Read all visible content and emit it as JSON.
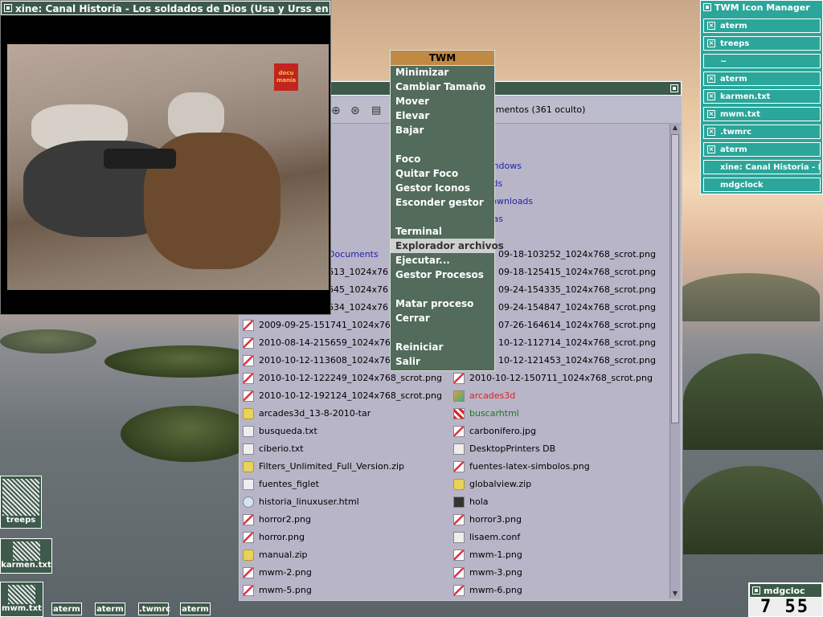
{
  "xine": {
    "title": "xine: Canal Historia - Los soldados de Dios (Usa y Urss en Afg",
    "logo": "docu mania"
  },
  "menu": {
    "title": "TWM",
    "items": [
      "Minimizar",
      "Cambiar Tamaño",
      "Mover",
      "Elevar",
      "Bajar",
      "Foco",
      "Quitar Foco",
      "Gestor Iconos",
      "Esconder gestor",
      "Terminal",
      "Explorador archivos",
      "Ejecutar...",
      "Gestor Procesos",
      "Matar proceso",
      "Cerrar",
      "Reiniciar",
      "Salir"
    ],
    "selected": "Explorador archivos"
  },
  "iconmgr": {
    "title": "TWM Icon Manager",
    "items": [
      "aterm",
      "treeps",
      "~",
      "aterm",
      "karmen.txt",
      "mwm.txt",
      ".twmrc",
      "aterm",
      "xine: Canal Historia - Los",
      "mdgclock"
    ]
  },
  "fm": {
    "status": "ementos (361 oculto)",
    "col_top": [
      "_windows",
      "loads",
      "aDownloads",
      "amas"
    ],
    "left": [
      "Documents",
      "613_1024x76",
      "645_1024x76",
      "634_1024x76",
      "2009-09-25-151741_1024x76",
      "2010-08-14-215659_1024x76",
      "2010-10-12-113608_1024x76",
      "2010-10-12-122249_1024x768_scrot.png",
      "2010-10-12-192124_1024x768_scrot.png",
      "arcades3d_13-8-2010-tar",
      "busqueda.txt",
      "ciberio.txt",
      "Filters_Unlimited_Full_Version.zip",
      "fuentes_figlet",
      "historia_linuxuser.html",
      "horror2.png",
      "horror.png",
      "manual.zip",
      "mwm-2.png",
      "mwm-5.png"
    ],
    "right": [
      "09-18-103252_1024x768_scrot.png",
      "09-18-125415_1024x768_scrot.png",
      "09-24-154335_1024x768_scrot.png",
      "09-24-154847_1024x768_scrot.png",
      "07-26-164614_1024x768_scrot.png",
      "10-12-112714_1024x768_scrot.png",
      "10-12-121453_1024x768_scrot.png",
      "2010-10-12-150711_1024x768_scrot.png",
      "arcades3d",
      "buscarhtml",
      "carbonifero.jpg",
      "DesktopPrinters DB",
      "fuentes-latex-simbolos.png",
      "globalview.zip",
      "hola",
      "horror3.png",
      "lisaem.conf",
      "mwm-1.png",
      "mwm-3.png",
      "mwm-6.png"
    ]
  },
  "desktop": {
    "icons": [
      "treeps",
      "karmen.txt",
      "mwm.txt"
    ],
    "small": [
      "aterm",
      "aterm",
      ".twmrc",
      "aterm"
    ],
    "clock_title": "mdgcloc",
    "clock_time": "7 55"
  },
  "colors": {
    "twm_title": "#3c5a4a",
    "menu_bg": "#526b5b",
    "menu_header": "#c08a45",
    "iconmgr_bg": "#2aa69a",
    "link_blue": "#22a",
    "red_text": "#d22",
    "green_text": "#1a7a1a"
  }
}
